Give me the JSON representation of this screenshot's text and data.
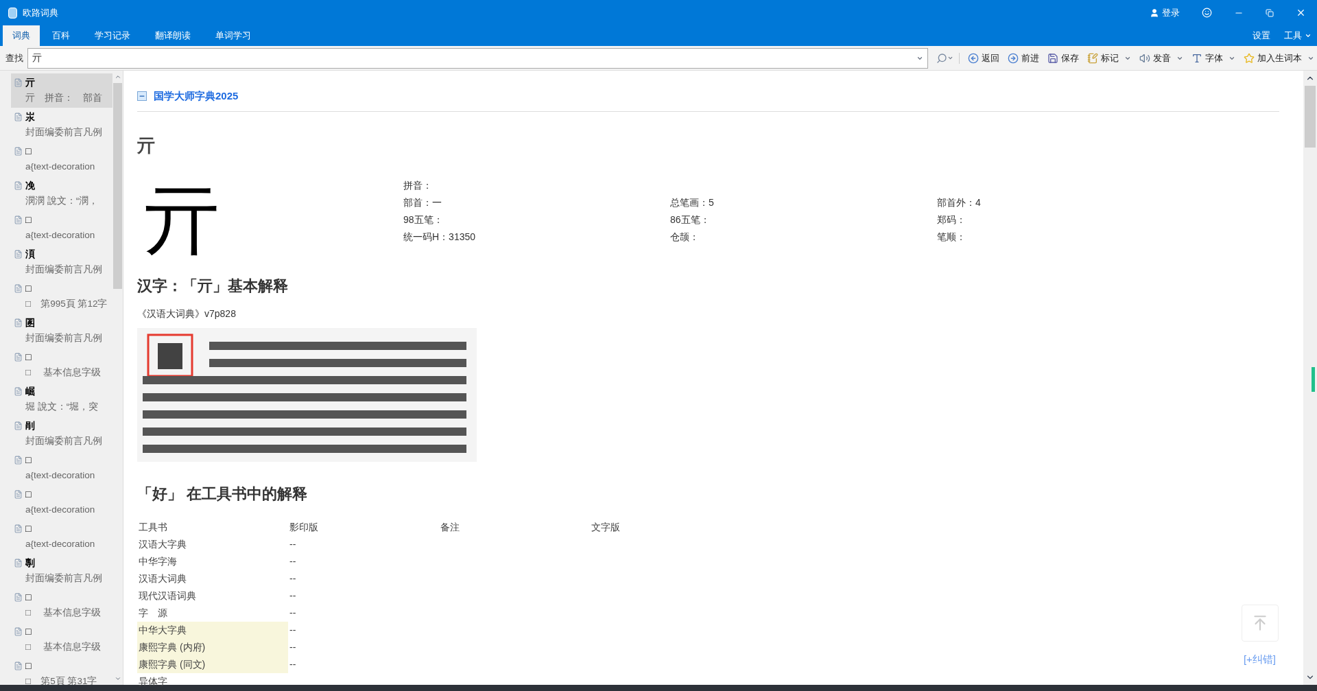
{
  "window": {
    "title": "欧路词典",
    "login": "登录"
  },
  "tabs": [
    {
      "label": "词典",
      "selected": true
    },
    {
      "label": "百科",
      "selected": false
    },
    {
      "label": "学习记录",
      "selected": false
    },
    {
      "label": "翻译朗读",
      "selected": false
    },
    {
      "label": "单词学习",
      "selected": false
    }
  ],
  "menu_right": [
    {
      "label": "设置",
      "has_menu": false
    },
    {
      "label": "工具",
      "has_menu": true
    }
  ],
  "search": {
    "label": "查找",
    "value": "亓"
  },
  "toolbar": [
    {
      "kind": "back",
      "label": "返回",
      "has_menu": false
    },
    {
      "kind": "forward",
      "label": "前进",
      "has_menu": false
    },
    {
      "kind": "save",
      "label": "保存",
      "has_menu": false
    },
    {
      "kind": "mark",
      "label": "标记",
      "has_menu": true
    },
    {
      "kind": "speak",
      "label": "发音",
      "has_menu": true
    },
    {
      "kind": "font",
      "label": "字体",
      "has_menu": true
    },
    {
      "kind": "star",
      "label": "加入生词本",
      "has_menu": true
    }
  ],
  "sidebar": {
    "items": [
      {
        "title": "亓",
        "snippet": "亓　拼音：　部首",
        "selected": true
      },
      {
        "title": "汖",
        "snippet": "封面编委前言凡例",
        "selected": false
      },
      {
        "title": "□",
        "snippet": "a{text-decoration",
        "selected": false
      },
      {
        "title": "凂",
        "snippet": "潣潣  說文：“潣，",
        "selected": false
      },
      {
        "title": "□",
        "snippet": "a{text-decoration",
        "selected": false
      },
      {
        "title": "湏",
        "snippet": "封面编委前言凡例",
        "selected": false
      },
      {
        "title": "□",
        "snippet": "□　第995頁 第12字",
        "selected": false
      },
      {
        "title": "圂",
        "snippet": "封面编委前言凡例",
        "selected": false
      },
      {
        "title": "□",
        "snippet": "□　 基本信息字级",
        "selected": false
      },
      {
        "title": "崛",
        "snippet": "堀  說文：“堀，突",
        "selected": false
      },
      {
        "title": "剈",
        "snippet": "封面编委前言凡例",
        "selected": false
      },
      {
        "title": "□",
        "snippet": "a{text-decoration",
        "selected": false
      },
      {
        "title": "□",
        "snippet": "a{text-decoration",
        "selected": false
      },
      {
        "title": "□",
        "snippet": "a{text-decoration",
        "selected": false
      },
      {
        "title": "剸",
        "snippet": "封面编委前言凡例",
        "selected": false
      },
      {
        "title": "□",
        "snippet": "□　 基本信息字级",
        "selected": false
      },
      {
        "title": "□",
        "snippet": "□　 基本信息字级",
        "selected": false
      },
      {
        "title": "□",
        "snippet": "□　第5頁 第31字",
        "selected": false
      }
    ]
  },
  "content": {
    "dictionary": "国学大师字典2025",
    "expanded": true,
    "heading": "亓",
    "big_char": "亓",
    "info": [
      [
        "拼音："
      ],
      [
        "部首：一",
        "总笔画：5",
        "部首外：4"
      ],
      [
        "98五笔：",
        "86五笔：",
        "郑码："
      ],
      [
        "统一码H：31350",
        "仓颉：",
        "笔顺："
      ]
    ],
    "basic_heading": "汉字：「亓」基本解释",
    "source": "《汉语大词典》v7p828",
    "scan": {
      "kind": "picture"
    },
    "tools_heading": "「好」 在工具书中的解释",
    "table": {
      "columns": [
        "工具书",
        "影印版",
        "备注",
        "文字版"
      ],
      "rows": [
        {
          "book": "汉语大字典",
          "scan": "--",
          "highlighted": false
        },
        {
          "book": "中华字海",
          "scan": "--",
          "highlighted": false
        },
        {
          "book": "汉语大词典",
          "scan": "--",
          "highlighted": false
        },
        {
          "book": "现代汉语词典",
          "scan": "--",
          "highlighted": false
        },
        {
          "book": "字　源",
          "scan": "--",
          "highlighted": false
        },
        {
          "book": "中华大字典",
          "scan": "--",
          "highlighted": true
        },
        {
          "book": "康熙字典 (内府)",
          "scan": "--",
          "highlighted": true
        },
        {
          "book": "康熙字典 (同文)",
          "scan": "--",
          "highlighted": true
        },
        {
          "book": "异体字",
          "highlighted": false
        }
      ]
    },
    "report_link": "[+纠错]"
  }
}
